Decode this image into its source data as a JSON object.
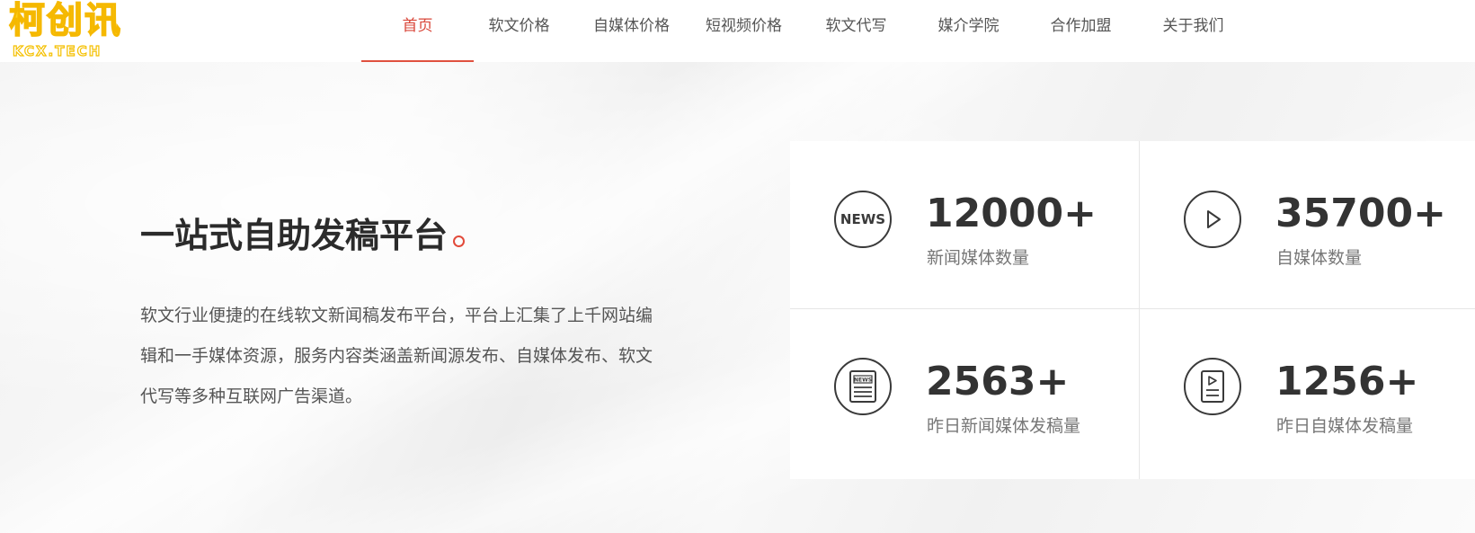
{
  "logo": {
    "main": "柯创讯",
    "sub": "KCX.TECH"
  },
  "nav": {
    "items": [
      {
        "label": "首页",
        "active": true
      },
      {
        "label": "软文价格"
      },
      {
        "label": "自媒体价格"
      },
      {
        "label": "短视频价格"
      },
      {
        "label": "软文代写"
      },
      {
        "label": "媒介学院"
      },
      {
        "label": "合作加盟"
      },
      {
        "label": "关于我们"
      }
    ]
  },
  "hero": {
    "title": "一站式自助发稿平台",
    "description": "软文行业便捷的在线软文新闻稿发布平台，平台上汇集了上千网站编辑和一手媒体资源，服务内容类涵盖新闻源发布、自媒体发布、软文代写等多种互联网广告渠道。"
  },
  "stats": [
    {
      "icon": "news-circle-icon",
      "icon_text": "NEWS",
      "value": "12000+",
      "label": "新闻媒体数量"
    },
    {
      "icon": "play-circle-icon",
      "value": "35700+",
      "label": "自媒体数量"
    },
    {
      "icon": "newspaper-icon",
      "icon_text": "NEWS",
      "value": "2563+",
      "label": "昨日新闻媒体发稿量"
    },
    {
      "icon": "video-document-icon",
      "value": "1256+",
      "label": "昨日自媒体发稿量"
    }
  ],
  "colors": {
    "accent": "#e0513f",
    "text_dark": "#2b2b2b",
    "text_muted": "#777777"
  }
}
